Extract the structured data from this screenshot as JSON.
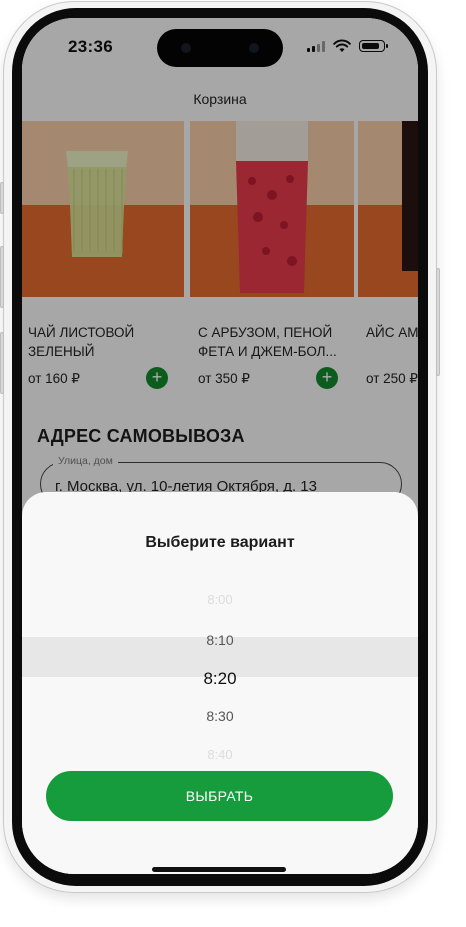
{
  "status_bar": {
    "time": "23:36"
  },
  "header": {
    "title": "Корзина"
  },
  "products": [
    {
      "name": "Чай листовой зеленый",
      "price": "от 160 ₽",
      "add_label": "+"
    },
    {
      "name": "С арбузом, пеной фета и джем-бол...",
      "price": "от 350 ₽",
      "add_label": "+"
    },
    {
      "name": "Айс ам",
      "price": "от 250 ₽"
    }
  ],
  "pickup": {
    "section_title": "АДРЕС САМОВЫВОЗА",
    "address_label": "Улица, дом",
    "address_value": "г. Москва, ул. 10-летия Октября, д. 13"
  },
  "sheet": {
    "title": "Выберите вариант",
    "options": [
      "8:00",
      "8:10",
      "8:20",
      "8:30",
      "8:40"
    ],
    "selected": "8:20",
    "button_label": "ВЫБРАТЬ"
  },
  "colors": {
    "accent": "#179c3d",
    "add_button": "#128a2c",
    "table": "#e0692e",
    "wall": "#f2c9a4"
  }
}
